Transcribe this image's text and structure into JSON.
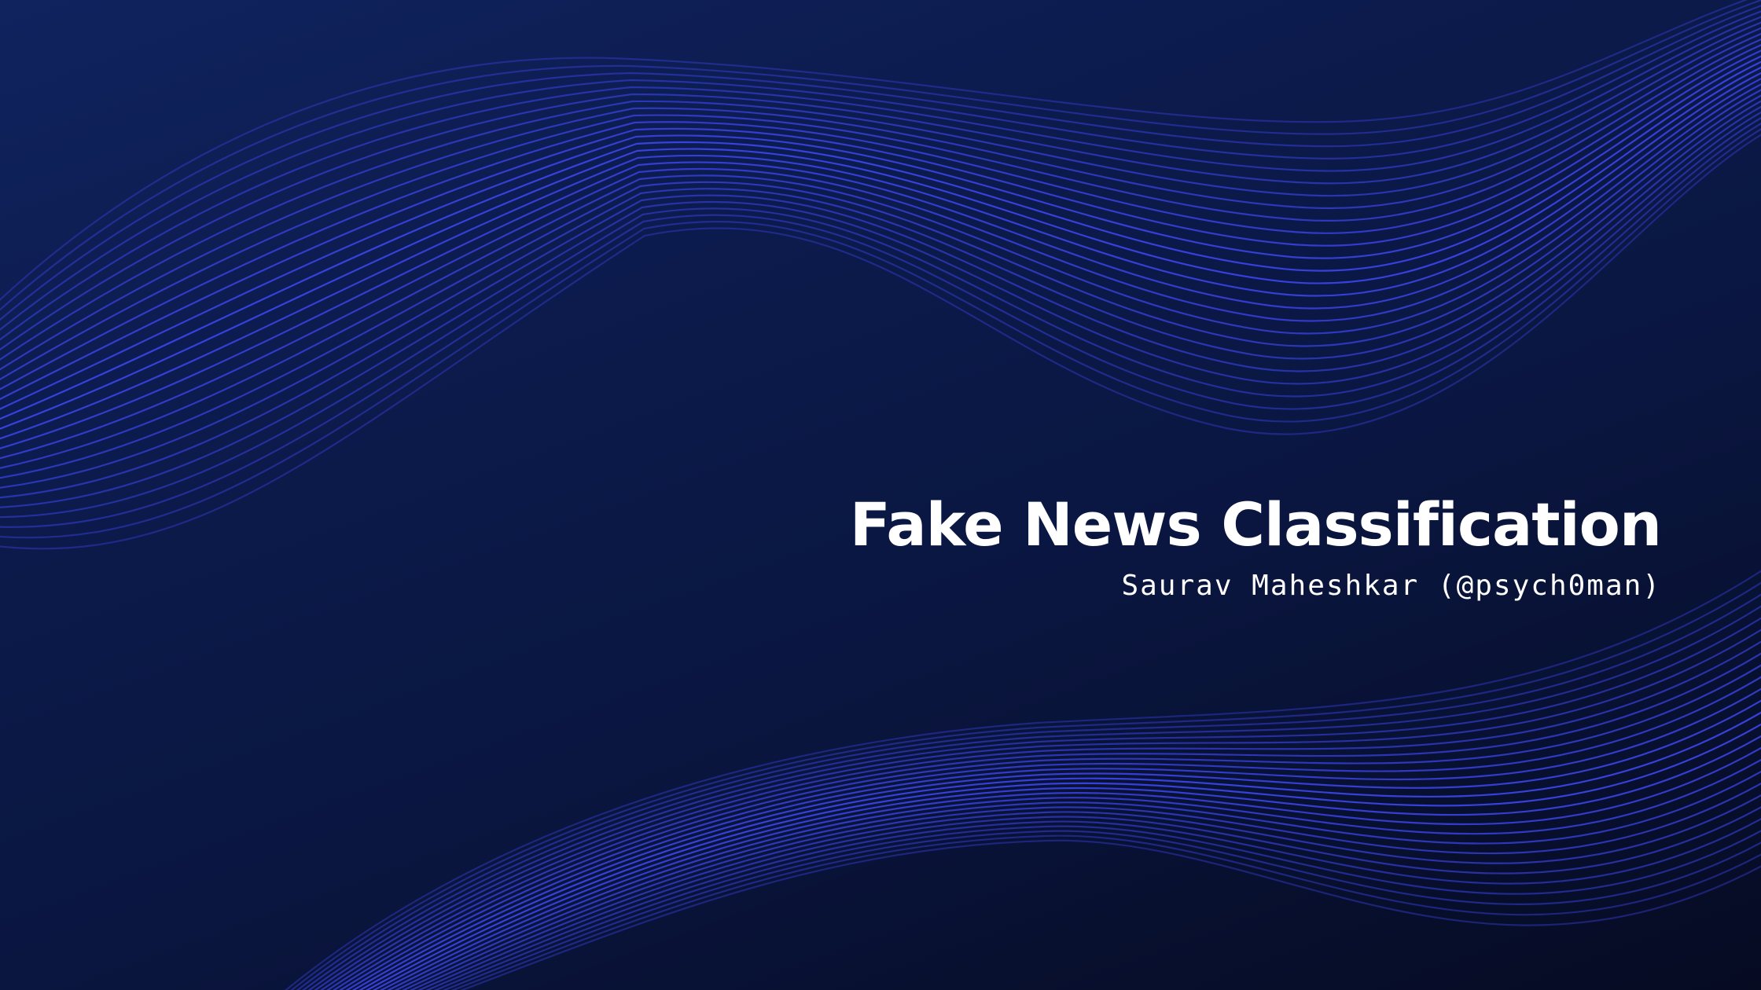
{
  "slide": {
    "title": "Fake News Classification",
    "subtitle": "Saurav Maheshkar (@psych0man)"
  },
  "colors": {
    "background_top": "#10235e",
    "background_bottom": "#060b22",
    "wave_line": "#3b44e6",
    "text": "#ffffff"
  }
}
